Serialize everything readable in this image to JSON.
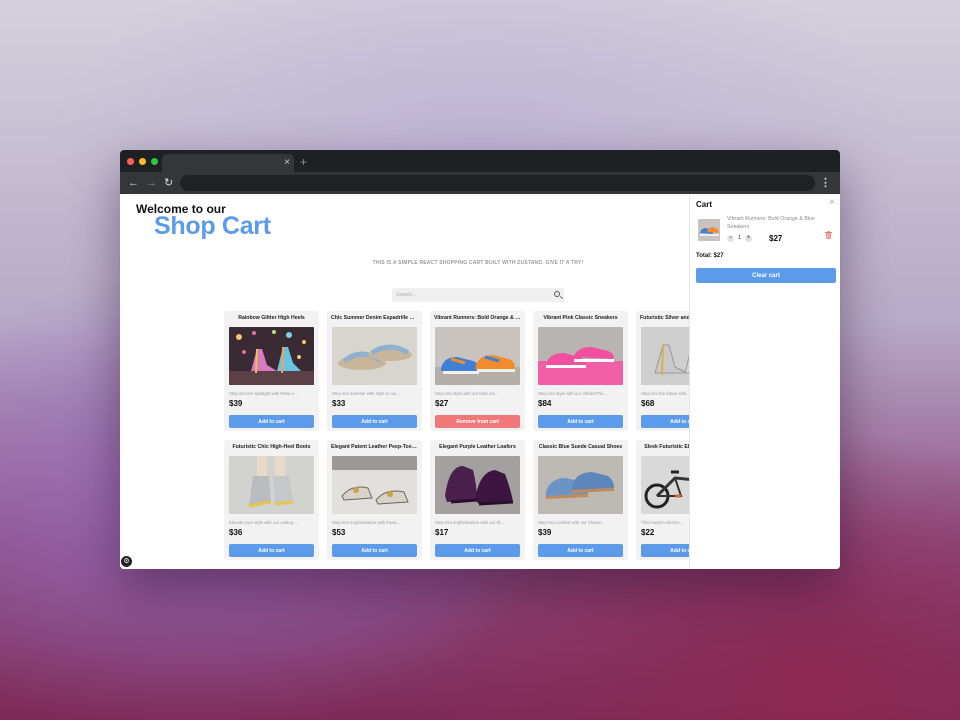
{
  "browser": {
    "dot_colors": [
      "#ff5f57",
      "#febc2e",
      "#28c840"
    ],
    "tab_close": "×",
    "new_tab": "+",
    "back": "←",
    "forward": "→",
    "reload": "↻",
    "menu": "⋮"
  },
  "header": {
    "welcome": "Welcome to our",
    "brand": "Shop Cart",
    "tagline": "THIS IS A SIMPLE REACT SHOPPING CART BUILT WITH ZUSTAND. GIVE IT A TRY!"
  },
  "search": {
    "placeholder": "Search..."
  },
  "products": [
    {
      "name": "Rainbow Glitter High Heels",
      "desc": "Step into the spotlight with these e...",
      "price": "$39",
      "button": "Add to cart",
      "icon": "rainbow-heels-photo"
    },
    {
      "name": "Chic Summer Denim Espadrille Sandals",
      "desc": "Step into summer with style in our...",
      "price": "$33",
      "button": "Add to cart",
      "icon": "denim-sandals-photo"
    },
    {
      "name": "Vibrant Runners: Bold Orange & Blue Sneakers",
      "desc": "Step into style with our bold ora...",
      "price": "$27",
      "button": "Remove from cart",
      "icon": "orange-blue-sneakers-photo"
    },
    {
      "name": "Vibrant Pink Classic Sneakers",
      "desc": "Step into style with our Vibrant Pin...",
      "price": "$84",
      "button": "Add to cart",
      "icon": "pink-sneakers-photo"
    },
    {
      "name": "Futuristic Silver and Gold High-Heel Boots",
      "desc": "Step into the future with...",
      "price": "$68",
      "button": "Add to cart",
      "icon": "silver-heels-photo"
    },
    {
      "name": "Futuristic Chic High-Heel Boots",
      "desc": "Elevate your style with our cutting-...",
      "price": "$36",
      "button": "Add to cart",
      "icon": "chic-boots-photo"
    },
    {
      "name": "Elegant Patent Leather Peep-Toe Pumps",
      "desc": "Step into sophistication with these...",
      "price": "$53",
      "button": "Add to cart",
      "icon": "peep-toe-pumps-photo"
    },
    {
      "name": "Elegant Purple Leather Loafers",
      "desc": "Step into sophistication with our El...",
      "price": "$17",
      "button": "Add to cart",
      "icon": "purple-loafers-photo"
    },
    {
      "name": "Classic Blue Suede Casual Shoes",
      "desc": "Step into comfort with our Classic...",
      "price": "$39",
      "button": "Add to cart",
      "icon": "blue-suede-shoes-photo"
    },
    {
      "name": "Sleek Futuristic Electric Bicycle",
      "desc": "This modern electric...",
      "price": "$22",
      "button": "Add to cart",
      "icon": "electric-bicycle-photo"
    }
  ],
  "cart": {
    "title": "Cart",
    "close": "×",
    "item": {
      "name": "Vibrant Runners: Bold Orange & Blue Sneakers",
      "qty": "1",
      "price": "$27",
      "minus": "−",
      "plus": "+"
    },
    "total": "Total: $27",
    "clear_label": "Clear cart"
  },
  "colors": {
    "accent": "#5b9bea",
    "remove": "#f07878"
  }
}
